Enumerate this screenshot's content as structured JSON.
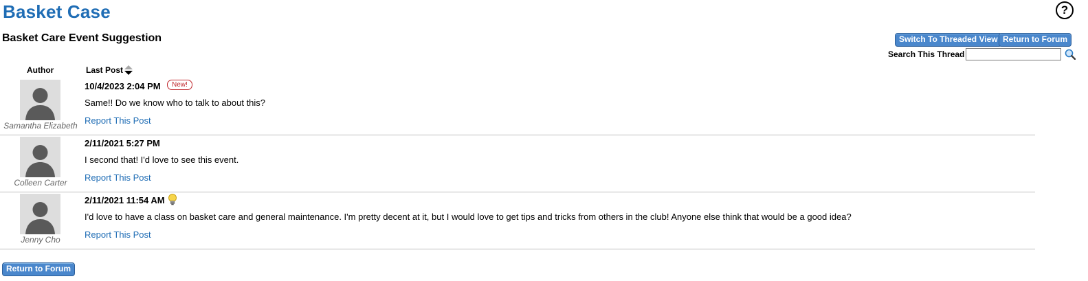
{
  "site": {
    "title": "Basket Case"
  },
  "thread": {
    "title": "Basket Care Event Suggestion"
  },
  "toolbar": {
    "threaded_view_label": "Switch To Threaded View",
    "return_label": "Return to Forum",
    "search_label": "Search This Thread",
    "search_value": ""
  },
  "columns": {
    "author": "Author",
    "last_post": "Last Post"
  },
  "posts": [
    {
      "author": "Samantha Elizabeth",
      "date": "10/4/2023 2:04 PM",
      "badge": "New!",
      "body": "Same!! Do we know who to talk to about this?",
      "report": "Report This Post"
    },
    {
      "author": "Colleen Carter",
      "date": "2/11/2021 5:27 PM",
      "body": "I second that! I'd love to see this event.",
      "report": "Report This Post"
    },
    {
      "author": "Jenny Cho",
      "date": "2/11/2021 11:54 AM",
      "icon": "lightbulb-icon",
      "body": "I'd love to have a class on basket care and general maintenance. I'm pretty decent at it, but I would love to get tips and tricks from others in the club! Anyone else think that would be a good idea?",
      "report": "Report This Post"
    }
  ],
  "footer": {
    "return_label": "Return to Forum"
  },
  "colors": {
    "title": "#1f6db5",
    "button": "#4a87cc",
    "badge": "#c0282d",
    "link": "#1f6db5"
  }
}
